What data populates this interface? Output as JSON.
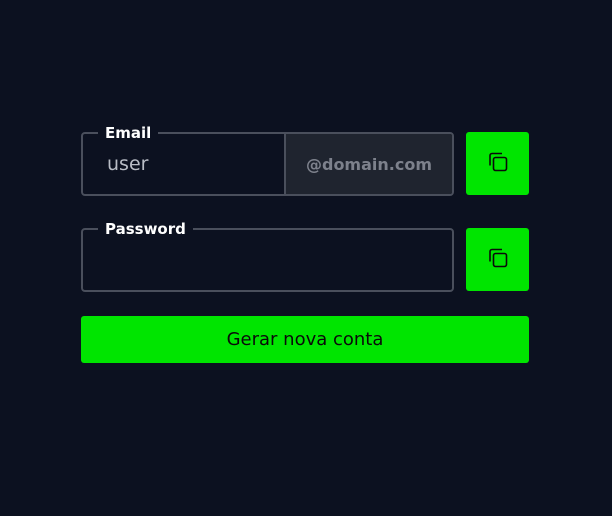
{
  "email": {
    "label": "Email",
    "placeholder": "user",
    "value": "",
    "domain": "@domain.com"
  },
  "password": {
    "label": "Password",
    "value": ""
  },
  "copy_icon": "copy-icon",
  "generate": {
    "label": "Gerar nova conta"
  },
  "colors": {
    "background": "#0c1120",
    "accent": "#00e500",
    "border": "#4a4f5c",
    "domain_bg": "#1f242f"
  }
}
